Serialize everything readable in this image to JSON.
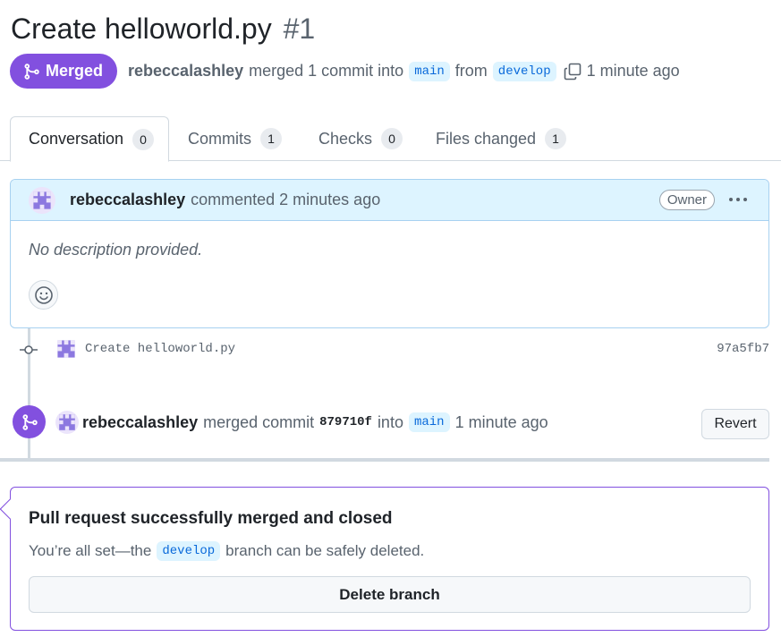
{
  "header": {
    "title": "Create helloworld.py",
    "number": "#1"
  },
  "meta": {
    "state": "Merged",
    "author": "rebeccalashley",
    "text_merged": "merged 1 commit into",
    "base_branch": "main",
    "text_from": "from",
    "head_branch": "develop",
    "time": "1 minute ago"
  },
  "tabs": [
    {
      "label": "Conversation",
      "count": "0"
    },
    {
      "label": "Commits",
      "count": "1"
    },
    {
      "label": "Checks",
      "count": "0"
    },
    {
      "label": "Files changed",
      "count": "1"
    }
  ],
  "comment": {
    "author": "rebeccalashley",
    "action": "commented 2 minutes ago",
    "badge": "Owner",
    "body": "No description provided."
  },
  "commit": {
    "message": "Create helloworld.py",
    "sha": "97a5fb7"
  },
  "merge_event": {
    "author": "rebeccalashley",
    "text_merged": "merged commit",
    "sha": "879710f",
    "text_into": "into",
    "branch": "main",
    "time": "1 minute ago",
    "revert_label": "Revert"
  },
  "merged_box": {
    "title": "Pull request successfully merged and closed",
    "desc_before": "You’re all set—the",
    "branch": "develop",
    "desc_after": "branch can be safely deleted.",
    "delete_label": "Delete branch"
  },
  "colors": {
    "merged_purple": "#8250df",
    "link_blue": "#0969da",
    "header_blue_bg": "#ddf4ff"
  }
}
